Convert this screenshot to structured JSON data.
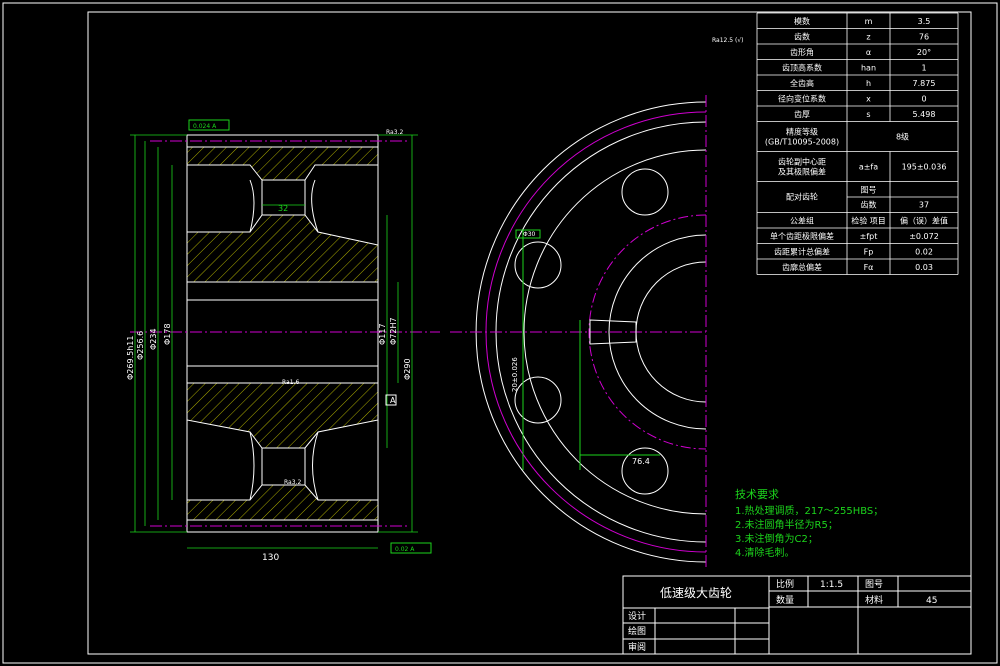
{
  "params": [
    {
      "name": "模数",
      "sym": "m",
      "val": "3.5"
    },
    {
      "name": "齿数",
      "sym": "z",
      "val": "76"
    },
    {
      "name": "齿形角",
      "sym": "α",
      "val": "20°"
    },
    {
      "name": "齿顶高系数",
      "sym": "han",
      "val": "1"
    },
    {
      "name": "全齿高",
      "sym": "h",
      "val": "7.875"
    },
    {
      "name": "径向变位系数",
      "sym": "x",
      "val": "0"
    },
    {
      "name": "齿厚",
      "sym": "s",
      "val": "5.498"
    }
  ],
  "precision": {
    "label1": "精度等级",
    "label2": "(GB/T10095-2008)",
    "val": "8级"
  },
  "center": {
    "label1": "齿轮副中心距",
    "label2": "及其极限偏差",
    "sym": "a±fa",
    "val": "195±0.036"
  },
  "mating": {
    "label": "配对齿轮",
    "r1": "图号",
    "r1val": "",
    "r2": "齿数",
    "r2val": "37"
  },
  "tolgroup": {
    "label": "公差组",
    "sym": "检验\n项目",
    "val": "偏（误）差值"
  },
  "tolerances": [
    {
      "name": "单个齿距极限偏差",
      "sym": "±fpt",
      "val": "±0.072"
    },
    {
      "name": "齿距累计总偏差",
      "sym": "Fp",
      "val": "0.02"
    },
    {
      "name": "齿廓总偏差",
      "sym": "Fα",
      "val": "0.03"
    }
  ],
  "tech": {
    "title": "技术要求",
    "items": [
      "1.热处理调质，217～255HBS；",
      "2.未注圆角半径为R5；",
      "3.未注倒角为C2；",
      "4.清除毛刺。"
    ]
  },
  "titleblock": {
    "name": "低速级大齿轮",
    "scale_label": "比例",
    "scale": "1:1.5",
    "drawno_label": "图号",
    "drawno": "",
    "qty_label": "数量",
    "qty": "",
    "material_label": "材料",
    "material": "45",
    "designer": "设计",
    "drafter": "绘图",
    "reviewer": "审阅"
  },
  "dims": {
    "width": "130",
    "hub": "32",
    "sym_a": "A",
    "d1": "Φ269.5h11",
    "d2": "Φ256.6",
    "d3": "Φ234",
    "d4": "Φ178",
    "d5": "Φ117",
    "d6": "Φ72H7",
    "d7": "Φ290",
    "key": "76.4",
    "keyw": "20±0.026",
    "bolt": "Φ30"
  },
  "marks": {
    "r_top": "Ra3.2",
    "r_mid": "Ra1.6",
    "r_corner": "Ra12.5  (√)",
    "tol_top": "0.024 A",
    "tol_bot": "0.02 A",
    "r_base": "Ra3.2"
  }
}
